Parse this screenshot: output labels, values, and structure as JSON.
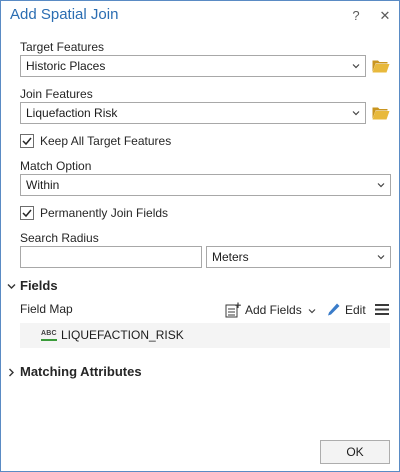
{
  "window": {
    "title": "Add Spatial Join",
    "help_label": "?",
    "close_label": "✕"
  },
  "target_features": {
    "label": "Target Features",
    "value": "Historic Places"
  },
  "join_features": {
    "label": "Join Features",
    "value": "Liquefaction Risk"
  },
  "keep_all": {
    "label": "Keep All Target Features",
    "checked": true
  },
  "match_option": {
    "label": "Match Option",
    "value": "Within"
  },
  "permanent_join": {
    "label": "Permanently Join Fields",
    "checked": true
  },
  "search_radius": {
    "label": "Search Radius",
    "value": "",
    "unit": "Meters"
  },
  "fields_section": {
    "title": "Fields",
    "field_map_label": "Field Map",
    "add_fields_label": "Add Fields",
    "edit_label": "Edit",
    "items": [
      {
        "type_badge": "ABC",
        "name": "LIQUEFACTION_RISK"
      }
    ]
  },
  "matching_section": {
    "title": "Matching Attributes"
  },
  "ok_label": "OK",
  "colors": {
    "title_blue": "#2a6db2",
    "folder_yellow": "#e8b93c",
    "edit_blue": "#3a7cc9",
    "field_green": "#3a9b3a"
  },
  "icons": [
    "help-icon",
    "close-icon",
    "chevron-down-icon",
    "folder-icon",
    "checkmark-icon",
    "caret-down-icon",
    "caret-right-icon",
    "add-fields-icon",
    "pencil-icon",
    "menu-icon",
    "text-field-icon"
  ]
}
